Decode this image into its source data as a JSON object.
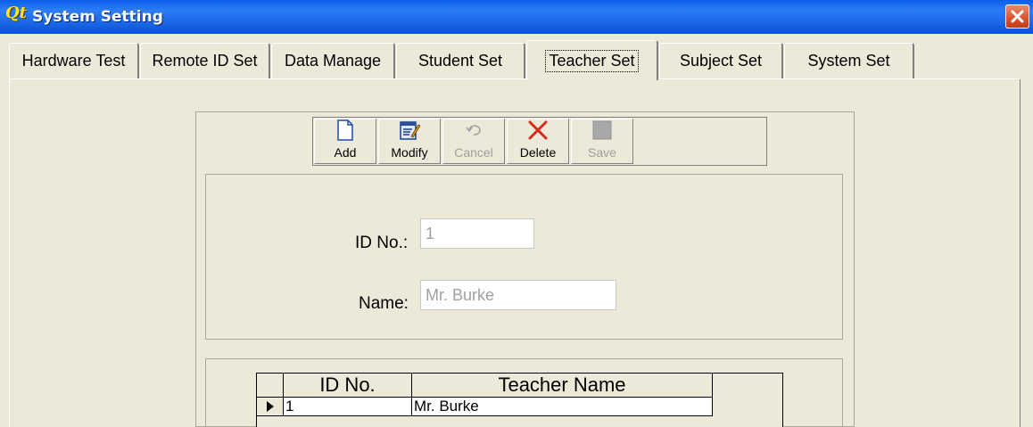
{
  "window": {
    "app_icon_text": "Qt",
    "title": "System Setting"
  },
  "tabs": [
    {
      "label": "Hardware Test"
    },
    {
      "label": "Remote ID Set"
    },
    {
      "label": "Data Manage"
    },
    {
      "label": "Student Set"
    },
    {
      "label": "Teacher Set",
      "active": true
    },
    {
      "label": "Subject Set"
    },
    {
      "label": "System Set"
    }
  ],
  "toolbar": {
    "add": "Add",
    "modify": "Modify",
    "cancel": "Cancel",
    "delete": "Delete",
    "save": "Save"
  },
  "form": {
    "id_label": "ID No.:",
    "id_value": "1",
    "name_label": "Name:",
    "name_value": "Mr. Burke"
  },
  "grid": {
    "columns": [
      "ID No.",
      "Teacher Name"
    ],
    "rows": [
      {
        "id": "1",
        "name": "Mr. Burke"
      }
    ]
  },
  "colors": {
    "title_bar": "#1a66e6",
    "close_button": "#d8532d",
    "delete_icon": "#d62a1c",
    "window_bg": "#ece9d8"
  }
}
